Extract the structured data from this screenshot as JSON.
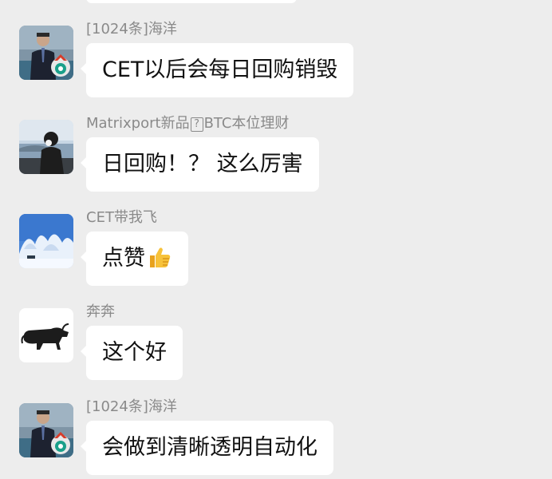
{
  "messages": [
    {
      "sender": "[1024条]海洋",
      "text": "CET以后会每日回购销毁",
      "avatar": "man-in-suit-with-badge-avatar"
    },
    {
      "sender_prefix": "Matrixport新品",
      "sender_box": "?",
      "sender_suffix": "BTC本位理财",
      "text": "日回购！？ 这么厉害",
      "avatar": "lakeside-silhouette-avatar"
    },
    {
      "sender": "CET带我飞",
      "text": "点赞",
      "emoji": "thumbs-up-icon",
      "avatar": "snowy-trees-avatar"
    },
    {
      "sender": "奔奔",
      "text": "这个好",
      "avatar": "bull-avatar"
    },
    {
      "sender": "[1024条]海洋",
      "text": "会做到清晰透明自动化",
      "avatar": "man-in-suit-with-badge-avatar"
    }
  ],
  "colors": {
    "background": "#ededed",
    "bubble": "#ffffff",
    "sender_text": "#8a8a8a",
    "message_text": "#111111"
  }
}
